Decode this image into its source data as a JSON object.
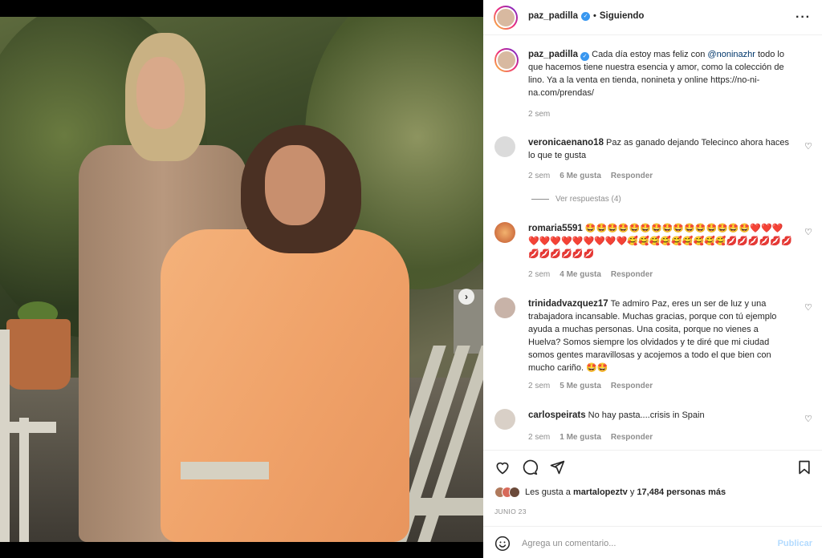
{
  "post": {
    "username": "paz_padilla",
    "following_label": "Siguiendo",
    "caption_username": "paz_padilla",
    "caption_before": "Cada día estoy mas feliz con ",
    "caption_mention": "@noninazhr",
    "caption_after": " todo lo que hacemos tiene nuestra esencia y amor, como la colección de lino. Ya a la venta en tienda, nonineta y online https://no-ni-na.com/prendas/",
    "caption_time": "2 sem"
  },
  "comments": [
    {
      "username": "veronicaenano18",
      "text": "Paz as ganado dejando Telecinco ahora haces lo que te gusta",
      "time": "2 sem",
      "likes": "6 Me gusta",
      "reply": "Responder",
      "avatar_color": "#dbdbdb"
    },
    {
      "username": "romaria5591",
      "text": "🤩🤩🤩🤩🤩🤩🤩🤩🤩🤩🤩🤩🤩🤩🤩❤️❤️❤️❤️❤️❤️❤️❤️❤️❤️❤️❤️🥰🥰🥰🥰🥰🥰🥰🥰🥰💋💋💋💋💋💋💋💋💋💋💋💋",
      "time": "2 sem",
      "likes": "4 Me gusta",
      "reply": "Responder",
      "avatar_color": "#e89a6b"
    },
    {
      "username": "trinidadvazquez17",
      "text": "Te admiro Paz, eres un ser de luz y una trabajadora incansable. Muchas gracias, porque con tú ejemplo ayuda a muchas personas. Una cosita, porque no vienes a Huelva? Somos siempre los olvidados y te diré que mi ciudad somos gentes maravillosas y acojemos a todo el que bien con mucho cariño. 🤩🤩",
      "time": "2 sem",
      "likes": "5 Me gusta",
      "reply": "Responder",
      "avatar_color": "#c8b3a8"
    },
    {
      "username": "carlospeirats",
      "text": "No hay pasta....crisis in Spain",
      "time": "2 sem",
      "likes": "1 Me gusta",
      "reply": "Responder",
      "avatar_color": "#d9d0c7"
    }
  ],
  "view_replies": "Ver respuestas (4)",
  "likes_summary": {
    "prefix": "Les gusta a ",
    "user": "martalopeztv",
    "middle": " y ",
    "count": "17,484 personas más"
  },
  "date": "JUNIO 23",
  "composer": {
    "placeholder": "Agrega un comentario...",
    "publish": "Publicar"
  },
  "icons": {
    "more": "more-icon",
    "verified": "verified-icon",
    "like": "heart-icon",
    "comment": "comment-icon",
    "share": "share-icon",
    "save": "bookmark-icon",
    "emoji": "emoji-icon",
    "next": "chevron-right-icon"
  },
  "colors": {
    "accent": "#0095f6",
    "verified": "#3897f0",
    "publish_disabled": "#b3dbff"
  }
}
